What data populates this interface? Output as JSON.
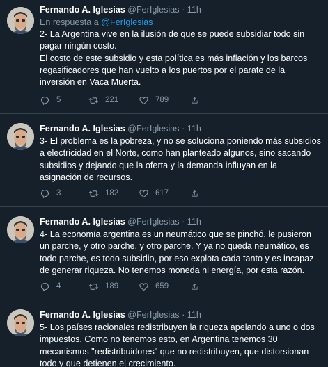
{
  "tweets": [
    {
      "name": "Fernando A. Iglesias",
      "handle": "@FerIglesias",
      "dot": "·",
      "time": "11h",
      "replying_prefix": "En respuesta a",
      "replying_to": "@FerIglesias",
      "text": "2- La Argentina vive en la ilusión de que se puede subsidiar todo sin pagar ningún costo.\nEl costo de este subsidio y esta política es más inflación y los barcos regasificadores que han vuelto a los puertos por el parate de la inversión en Vaca Muerta.",
      "replies": "5",
      "retweets": "221",
      "likes": "789"
    },
    {
      "name": "Fernando A. Iglesias",
      "handle": "@FerIglesias",
      "dot": "·",
      "time": "11h",
      "text": "3- El problema es la pobreza, y no se soluciona poniendo más subsidios a electricidad en el Norte, como han planteado algunos, sino sacando subsidios y dejando que la oferta y la demanda influyan en la asignación de recursos.",
      "replies": "3",
      "retweets": "182",
      "likes": "617"
    },
    {
      "name": "Fernando A. Iglesias",
      "handle": "@FerIglesias",
      "dot": "·",
      "time": "11h",
      "text": "4- La economía argentina es un neumático que se pinchó, le pusieron un parche, y otro parche, y otro parche. Y ya no queda neumático, es todo parche, es todo subsidio, por eso explota cada tanto y es incapaz de generar riqueza. No tenemos moneda ni energía, por esta razón.",
      "replies": "4",
      "retweets": "189",
      "likes": "659"
    },
    {
      "name": "Fernando A. Iglesias",
      "handle": "@FerIglesias",
      "dot": "·",
      "time": "11h",
      "text": "5- Los países racionales redistribuyen la riqueza apelando a uno o dos impuestos. Como no tenemos esto, en Argentina tenemos 30 mecanismos \"redistribuidores\" que no redistribuyen, que distorsionan todo y que detienen el crecimiento."
    }
  ],
  "colors": {
    "background": "#15202b",
    "divider": "#38444d",
    "secondary_text": "#8899a6",
    "link": "#1da1f2"
  },
  "icons": [
    "reply-icon",
    "retweet-icon",
    "like-icon",
    "share-icon"
  ]
}
